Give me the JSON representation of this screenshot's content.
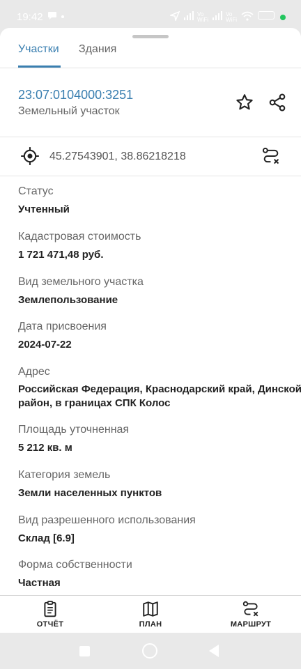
{
  "status_bar": {
    "time": "19:42",
    "indicators": [
      "chat-bubble-icon",
      "dot-icon",
      "location-icon",
      "signal-icon",
      "vowifi-icon",
      "signal-icon",
      "vowifi-icon",
      "wifi-icon",
      "battery-dot"
    ]
  },
  "tabs": [
    {
      "label": "Участки",
      "active": true
    },
    {
      "label": "Здания",
      "active": false
    }
  ],
  "parcel": {
    "cadastral_number": "23:07:0104000:3251",
    "type": "Земельный участок"
  },
  "coordinates": "45.27543901, 38.86218218",
  "fields": [
    {
      "label": "Статус",
      "value": "Учтенный"
    },
    {
      "label": "Кадастровая стоимость",
      "value": "1 721 471,48 руб."
    },
    {
      "label": "Вид земельного участка",
      "value": "Землепользование"
    },
    {
      "label": "Дата присвоения",
      "value": "2024-07-22"
    },
    {
      "label": "Адрес",
      "value": "Российская Федерация, Краснодарский край, Динской район, в границах СПК Колос"
    },
    {
      "label": "Площадь уточненная",
      "value": "5 212 кв. м"
    },
    {
      "label": "Категория земель",
      "value": "Земли населенных пунктов"
    },
    {
      "label": "Вид разрешенного использования",
      "value": "Склад [6.9]"
    },
    {
      "label": "Форма собственности",
      "value": "Частная"
    }
  ],
  "actions": [
    {
      "label": "ОТЧЁТ",
      "icon": "report-icon"
    },
    {
      "label": "ПЛАН",
      "icon": "map-icon"
    },
    {
      "label": "МАРШРУТ",
      "icon": "route-icon"
    }
  ],
  "colors": {
    "accent": "#3a7fb0",
    "system_bar": "#e9e9e9",
    "battery": "#22c55e"
  }
}
